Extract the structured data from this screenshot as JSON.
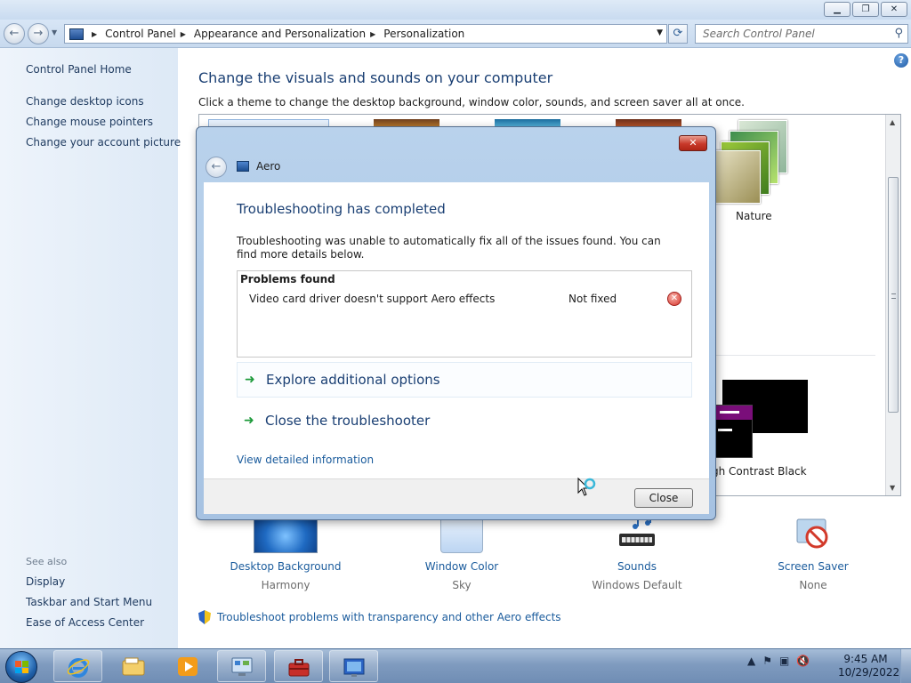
{
  "window": {
    "minimize_label": "▁",
    "maximize_label": "❐",
    "close_label": "✕"
  },
  "address": {
    "back_label": "←",
    "forward_label": "→",
    "breadcrumbs": [
      "Control Panel",
      "Appearance and Personalization",
      "Personalization"
    ],
    "search_placeholder": "Search Control Panel"
  },
  "left_pane": {
    "home": "Control Panel Home",
    "links": [
      "Change desktop icons",
      "Change mouse pointers",
      "Change your account picture"
    ],
    "see_also_heading": "See also",
    "see_also": [
      "Display",
      "Taskbar and Start Menu",
      "Ease of Access Center"
    ]
  },
  "main": {
    "title": "Change the visuals and sounds on your computer",
    "subtitle": "Click a theme to change the desktop background, window color, sounds, and screen saver all at once.",
    "themes": [
      {
        "name": "Nature"
      },
      {
        "name": "High Contrast Black",
        "visible_label": "gh Contrast Black"
      }
    ],
    "bottom_items": [
      {
        "label": "Desktop Background",
        "sub": "Harmony",
        "icon": "desktop-background-icon"
      },
      {
        "label": "Window Color",
        "sub": "Sky",
        "icon": "window-color-icon"
      },
      {
        "label": "Sounds",
        "sub": "Windows Default",
        "icon": "sounds-icon"
      },
      {
        "label": "Screen Saver",
        "sub": "None",
        "icon": "screen-saver-icon"
      }
    ],
    "aero_link": "Troubleshoot problems with transparency and other Aero effects"
  },
  "dialog": {
    "app_title": "Aero",
    "heading": "Troubleshooting has completed",
    "description": "Troubleshooting was unable to automatically fix all of the issues found. You can find more details below.",
    "problems_header": "Problems found",
    "problems": [
      {
        "name": "Video card driver doesn't support Aero effects",
        "status": "Not fixed"
      }
    ],
    "options": [
      "Explore additional options",
      "Close the troubleshooter"
    ],
    "view_details": "View detailed information",
    "close_button": "Close"
  },
  "taskbar": {
    "time": "9:45 AM",
    "date": "10/29/2022",
    "pinned": [
      "internet-explorer-icon",
      "windows-explorer-icon",
      "media-player-icon",
      "control-panel-icon",
      "toolbox-icon",
      "aero-troubleshooter-icon"
    ]
  },
  "colors": {
    "link": "#1a5b9c",
    "heading": "#1a3f73",
    "error_red": "#d8332a",
    "accent_green": "#1d9a3a"
  }
}
